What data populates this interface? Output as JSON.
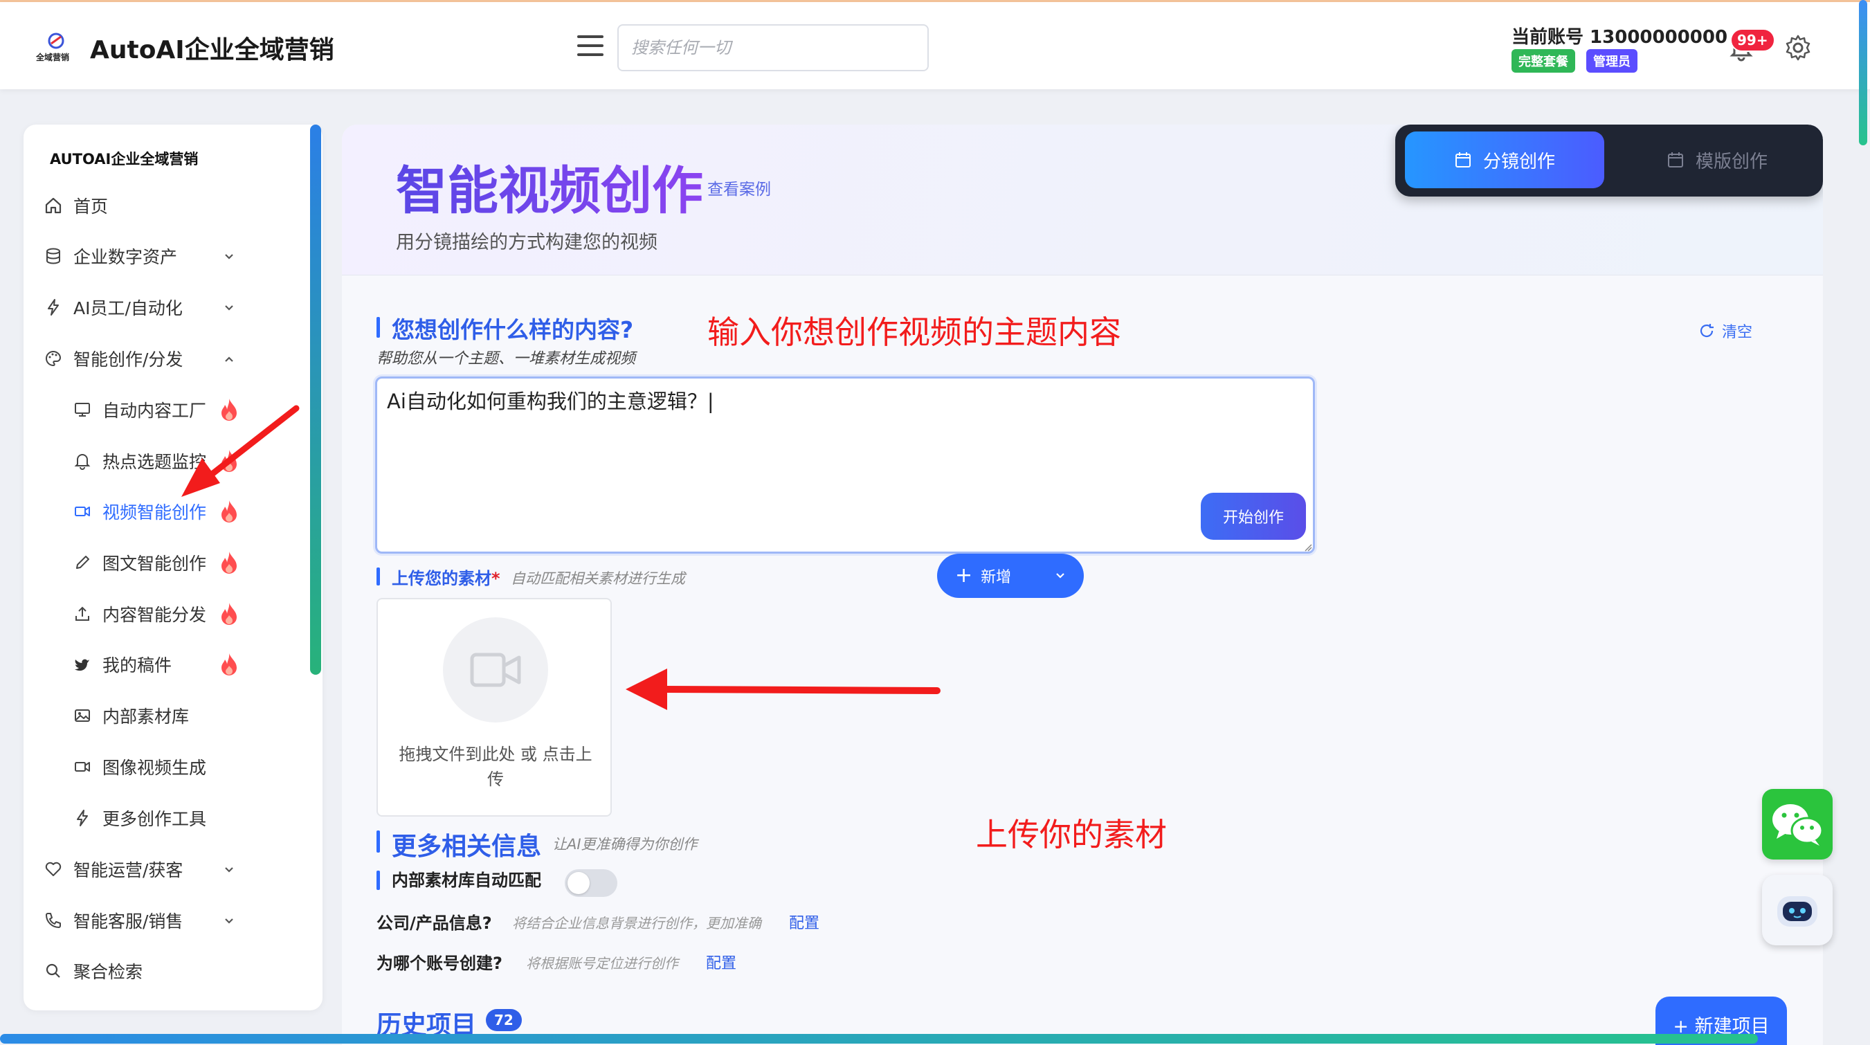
{
  "header": {
    "app_title": "AutoAI企业全域营销",
    "logo_text": "全域营销",
    "search_placeholder": "搜索任何一切",
    "account_label": "当前账号 13000000000",
    "plan_badge": "完整套餐",
    "role_badge": "管理员",
    "notification_count": "99+"
  },
  "sidebar": {
    "title": "AUTOAI企业全域营销",
    "items": [
      {
        "label": "首页",
        "icon": "home-icon"
      },
      {
        "label": "企业数字资产",
        "icon": "database-icon"
      },
      {
        "label": "AI员工/自动化",
        "icon": "lightning-icon"
      },
      {
        "label": "智能创作/分发",
        "icon": "palette-icon"
      },
      {
        "label": "自动内容工厂",
        "icon": "monitor-icon"
      },
      {
        "label": "热点选题监控",
        "icon": "bell-icon"
      },
      {
        "label": "视频智能创作",
        "icon": "video-icon"
      },
      {
        "label": "图文智能创作",
        "icon": "pen-icon"
      },
      {
        "label": "内容智能分发",
        "icon": "upload-icon"
      },
      {
        "label": "我的稿件",
        "icon": "bird-icon"
      },
      {
        "label": "内部素材库",
        "icon": "image-icon"
      },
      {
        "label": "图像视频生成",
        "icon": "video-icon"
      },
      {
        "label": "更多创作工具",
        "icon": "lightning-icon"
      },
      {
        "label": "智能运营/获客",
        "icon": "heart-icon"
      },
      {
        "label": "智能客服/销售",
        "icon": "phone-icon"
      },
      {
        "label": "聚合检索",
        "icon": "search-icon"
      }
    ]
  },
  "hero": {
    "title": "智能视频创作",
    "case_link": "查看案例",
    "subtitle": "用分镜描绘的方式构建您的视频"
  },
  "modes": {
    "storyboard": "分镜创作",
    "template": "模版创作"
  },
  "prompt_section": {
    "title": "您想创作什么样的内容?",
    "subtitle": "帮助您从一个主题、一堆素材生成视频",
    "annotation": "输入你想创作视频的主题内容",
    "clear": "清空",
    "value": "Ai自动化如何重构我们的主意逻辑？|",
    "start_button": "开始创作"
  },
  "upload_section": {
    "title": "上传您的素材",
    "required_mark": "*",
    "hint": "自动匹配相关素材进行生成",
    "add_button": "新增",
    "drop_text": "拖拽文件到此处 或 点击上传",
    "annotation": "上传你的素材"
  },
  "more_section": {
    "title": "更多相关信息",
    "hint": "让AI更准确得为你创作",
    "match_label": "内部素材库自动匹配",
    "match_enabled": false,
    "company_label": "公司/产品信息?",
    "company_hint": "将结合企业信息背景进行创作，更加准确",
    "company_link": "配置",
    "account_label": "为哪个账号创建?",
    "account_hint": "将根据账号定位进行创作",
    "account_link": "配置"
  },
  "history": {
    "title": "历史项目",
    "count": "72",
    "new_button": "+ 新建项目"
  },
  "colors": {
    "accent": "#2f6cff",
    "title_gradient_start": "#5a47e6",
    "annotation_red": "#f21c1c",
    "plan_green": "#2fb757",
    "admin_purple": "#5b4dff"
  }
}
